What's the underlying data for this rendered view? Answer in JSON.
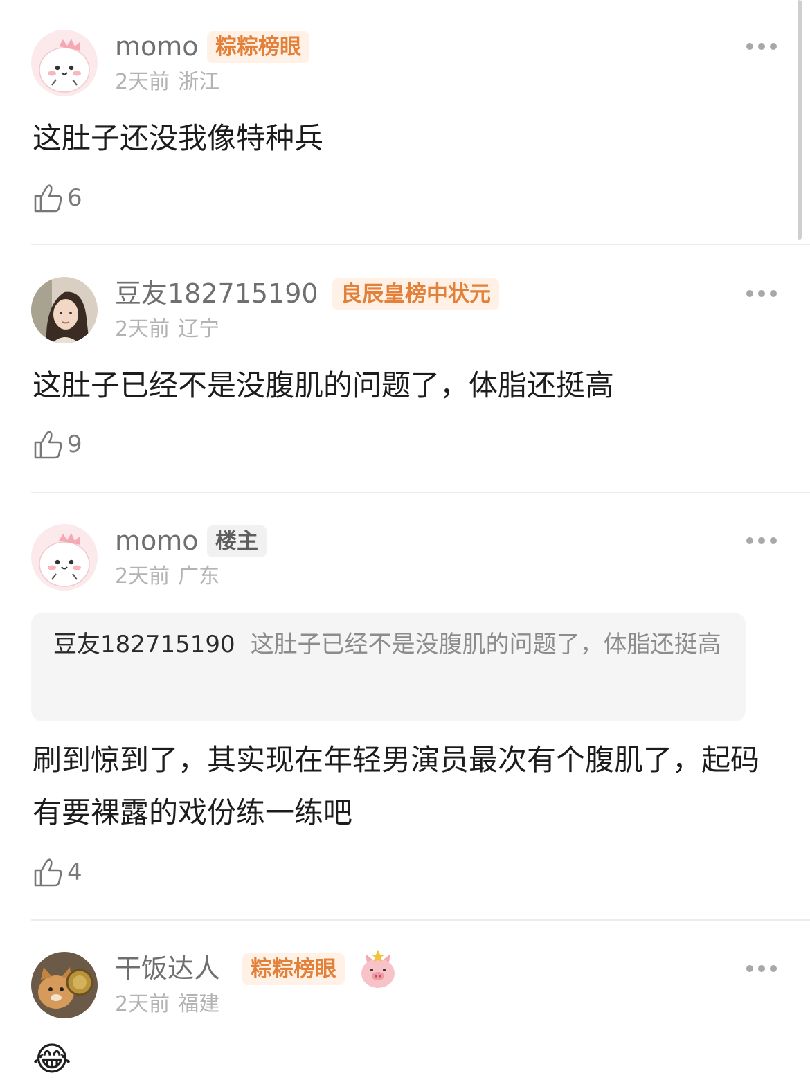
{
  "comments": [
    {
      "username": "momo",
      "badge": "粽粽榜眼",
      "time": "2天前",
      "location": "浙江",
      "text": "这肚子还没我像特种兵",
      "likes": "6",
      "avatar": "cartoon-pink-dinosaur-avatar"
    },
    {
      "username": "豆友182715190",
      "badge": "良辰皇榜中状元",
      "time": "2天前",
      "location": "辽宁",
      "text": "这肚子已经不是没腹肌的问题了，体脂还挺高",
      "likes": "9",
      "avatar": "woman-photo-avatar"
    },
    {
      "username": "momo",
      "badge": "楼主",
      "time": "2天前",
      "location": "广东",
      "quote_name": "豆友182715190",
      "quote_text": "这肚子已经不是没腹肌的问题了，体脂还挺高",
      "text": "刷到惊到了，其实现在年轻男演员最次有个腹肌了，起码有要裸露的戏份练一练吧",
      "likes": "4",
      "avatar": "cartoon-pink-dinosaur-avatar"
    },
    {
      "username": "干饭达人",
      "badge": "粽粽榜眼",
      "time": "2天前",
      "location": "福建",
      "text_emoji": "😂",
      "avatar": "cat-photo-avatar"
    }
  ],
  "colors": {
    "badge_orange_bg": "#fff1e6",
    "badge_orange_text": "#e3813a",
    "owner_badge_bg": "#f1f1f1",
    "meta_text": "#b3b3b3"
  }
}
